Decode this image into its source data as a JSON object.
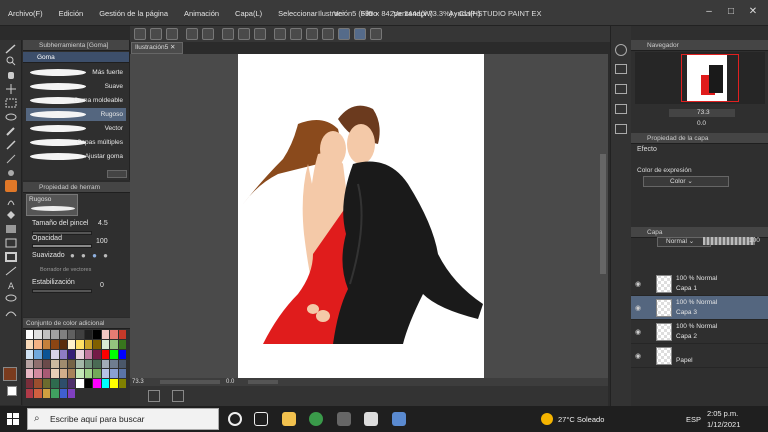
{
  "menu": [
    "Archivo(F)",
    "Edición",
    "Gestión de la página",
    "Animación",
    "Capa(L)",
    "Seleccionar",
    "Ver",
    "Filtro",
    "Ventana(W)",
    "Ayuda(H)"
  ],
  "window_title": "Ilustración5 (595 x 842px 144dpi 73.3%) - CLIP STUDIO PAINT EX",
  "document_tab": "Ilustración5",
  "subtool": {
    "header": "Subherramienta [Goma]",
    "group": "Goma",
    "brushes": [
      "Más fuerte",
      "Suave",
      "Goma moldeable",
      "Rugoso",
      "Vector",
      "Capas múltiples",
      "Ajustar goma"
    ],
    "selected_index": 3
  },
  "tool_property": {
    "header": "Propiedad de herram",
    "preset_name": "Rugoso",
    "brush_size_label": "Tamaño del pincel",
    "brush_size_value": "4.5",
    "opacity_label": "Opacidad",
    "opacity_value": "100",
    "antialias_label": "Suavizado",
    "vector_eraser_label": "Borrador de vectores",
    "stabilization_label": "Estabilización",
    "stabilization_value": "0"
  },
  "color_set": {
    "header": "Conjunto de color adicional",
    "colors": [
      "#ffffff",
      "#e0e0e0",
      "#c0c0c0",
      "#a0a0a0",
      "#808080",
      "#606060",
      "#404040",
      "#202020",
      "#000000",
      "#f4c7c3",
      "#e67c73",
      "#c53929",
      "#f8d9b8",
      "#f4b183",
      "#c5803b",
      "#8b4513",
      "#5a2d0c",
      "#fff2cc",
      "#ffe066",
      "#c9a227",
      "#7f6000",
      "#d9ead3",
      "#93c47d",
      "#38761d",
      "#cfe2f3",
      "#6fa8dc",
      "#0b5394",
      "#d9d2e9",
      "#8e7cc3",
      "#351c75",
      "#ead1dc",
      "#c27ba0",
      "#741b47",
      "#ff0000",
      "#00ff00",
      "#0000ff",
      "#b7a3a3",
      "#8f6f6f",
      "#6a4a4a",
      "#c9b9a0",
      "#a08c6e",
      "#746246",
      "#a3b7a8",
      "#6f8f79",
      "#4a6a54",
      "#a3acb7",
      "#6f7d8f",
      "#4a576a",
      "#e8b7c4",
      "#d28aa0",
      "#a85a74",
      "#e8d0b7",
      "#d2ae8a",
      "#a8825a",
      "#c4e8b7",
      "#a0d28a",
      "#74a85a",
      "#b7c4e8",
      "#8aa0d2",
      "#5a74a8",
      "#7a2e3a",
      "#9b4e2e",
      "#6b6b2e",
      "#2e6b4e",
      "#2e4e6b",
      "#4e2e6b",
      "#ffffff",
      "#000000",
      "#ff00ff",
      "#00ffff",
      "#ffff00",
      "#808000",
      "#b03a48",
      "#d06040",
      "#d0a040",
      "#40a060",
      "#4060d0",
      "#8040c0"
    ],
    "current_color": "#7a3b1e"
  },
  "status": {
    "zoom": "73.3",
    "angle": "0.0"
  },
  "right": {
    "navigator_header": "Navegador",
    "nav_zoom": "73.3",
    "nav_angle": "0.0",
    "layer_property_header": "Propiedad de la capa",
    "effect_label": "Efecto",
    "expression_color_label": "Color de expresión",
    "expression_color_value": "Color",
    "layer_header": "Capa",
    "blend_mode": "Normal",
    "opacity_field": "100",
    "layers": [
      {
        "mode": "100 % Normal",
        "name": "Capa 1",
        "selected": false
      },
      {
        "mode": "100 % Normal",
        "name": "Capa 3",
        "selected": true
      },
      {
        "mode": "100 % Normal",
        "name": "Capa 2",
        "selected": false
      },
      {
        "mode": "",
        "name": "Papel",
        "selected": false
      }
    ]
  },
  "taskbar": {
    "search_placeholder": "Escribe aquí para buscar",
    "weather": "27°C  Soleado",
    "language": "ESP",
    "time": "2:05 p.m.",
    "date": "1/12/2021"
  }
}
